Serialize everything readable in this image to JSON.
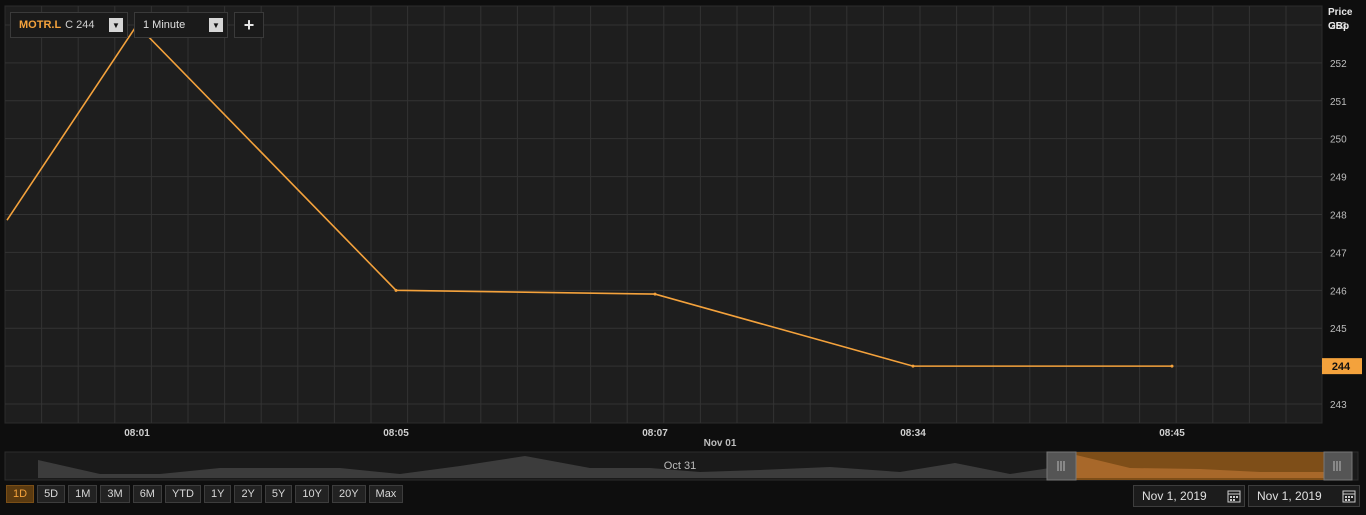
{
  "toolbar": {
    "symbol": "MOTR.L",
    "close_label": "C 244",
    "interval": "1 Minute",
    "add_label": "+"
  },
  "axis_unit": {
    "line1": "Price",
    "line2": "GBp"
  },
  "navigator_label": "Oct 31",
  "ranges": [
    "1D",
    "5D",
    "1M",
    "3M",
    "6M",
    "YTD",
    "1Y",
    "2Y",
    "5Y",
    "10Y",
    "20Y",
    "Max"
  ],
  "active_range": "1D",
  "date_from": "Nov 1, 2019",
  "date_to": "Nov 1, 2019",
  "colors": {
    "line": "#f4a23c",
    "background": "#1e1e1e",
    "grid": "#333333"
  },
  "chart_data": {
    "type": "line",
    "x": [
      "08:01",
      "08:05",
      "08:07",
      "08:34",
      "08:45"
    ],
    "x_sublabel": "Nov 01",
    "series": [
      {
        "values": [
          253,
          246,
          245.9,
          244,
          244
        ]
      }
    ],
    "start_value": 247.85,
    "ylim": [
      242.5,
      253.5
    ],
    "y_ticks": [
      243,
      244,
      245,
      246,
      247,
      248,
      249,
      250,
      251,
      252,
      253
    ],
    "last_price": 244,
    "grid": true
  }
}
